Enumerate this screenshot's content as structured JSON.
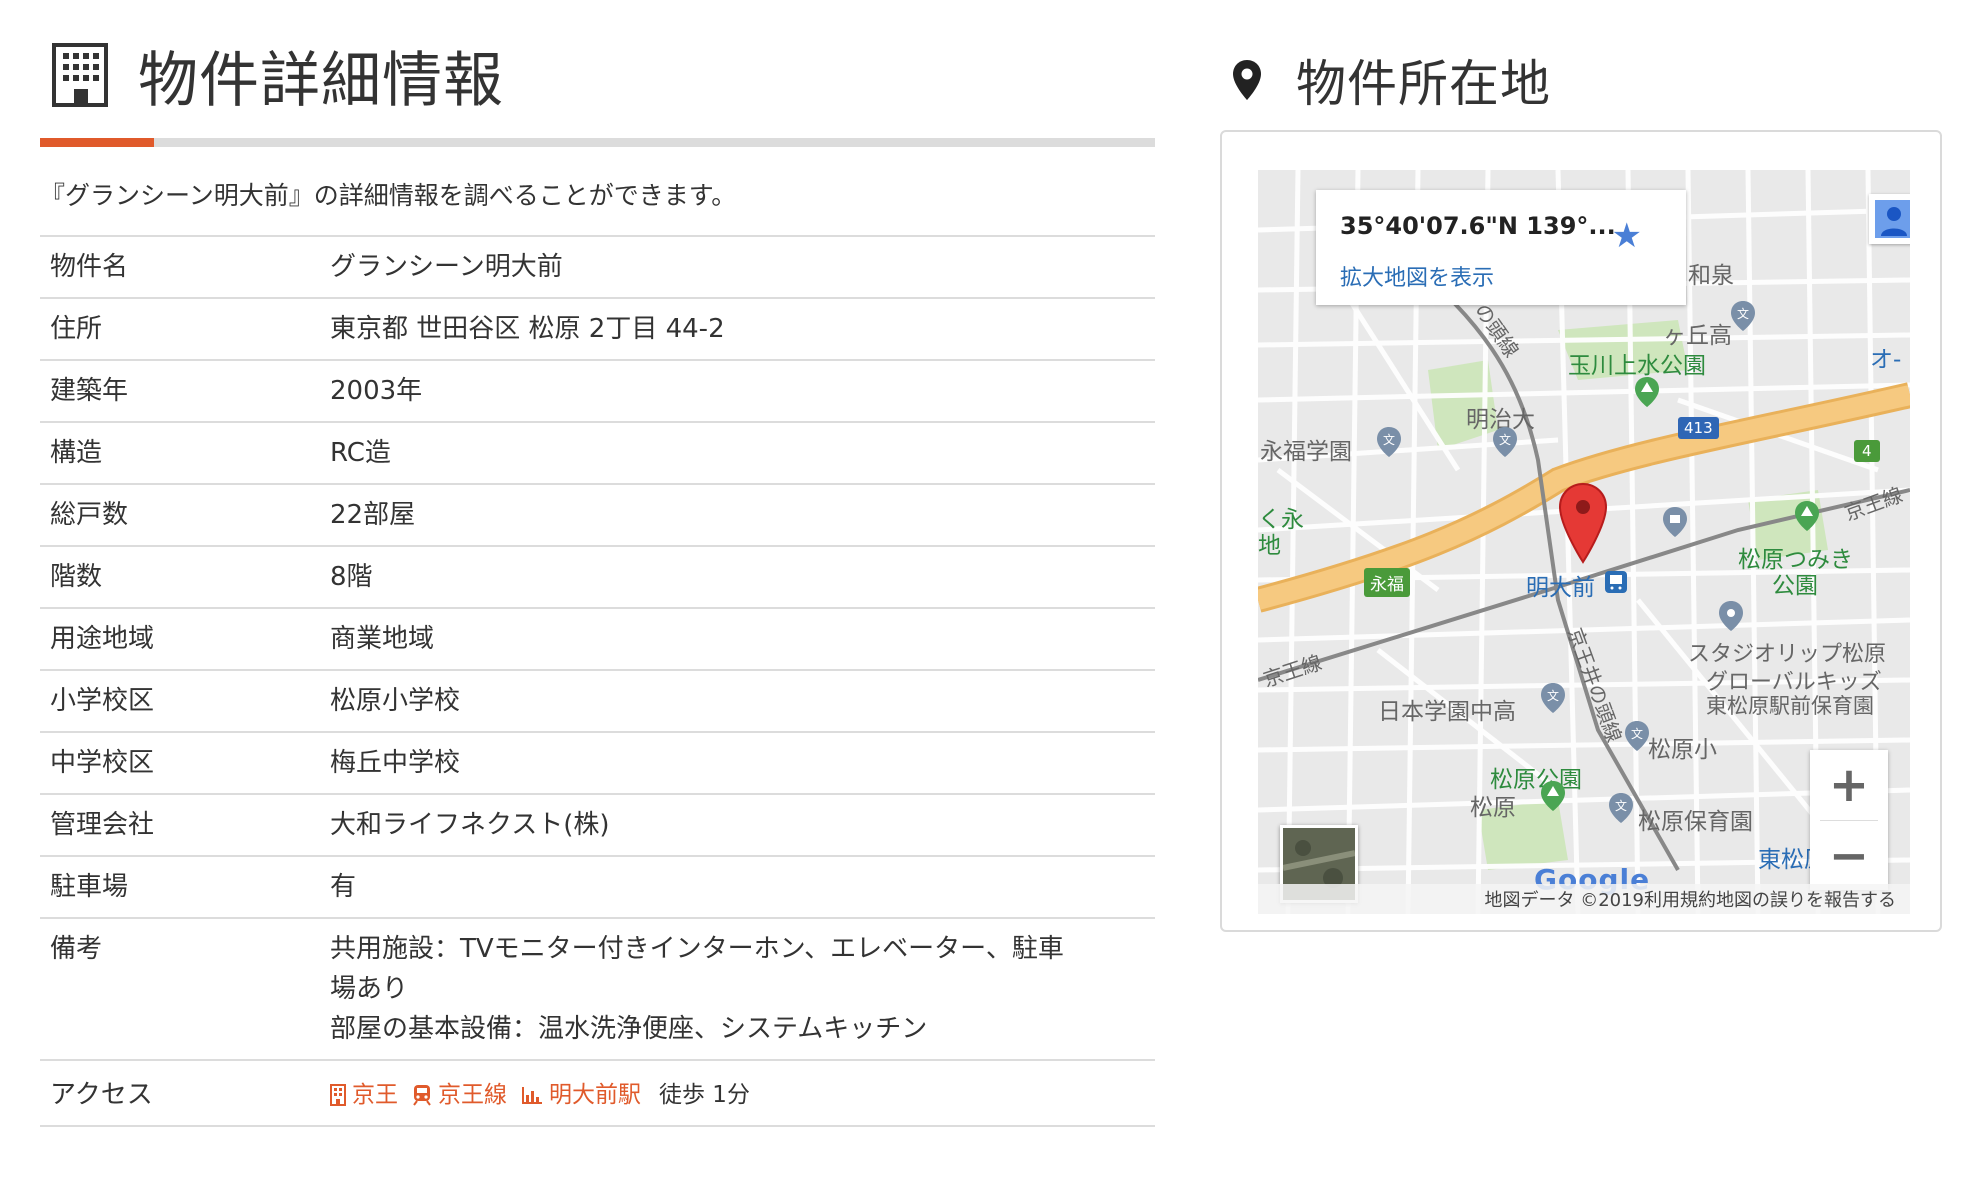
{
  "detail": {
    "title": "物件詳細情報",
    "description": "『グランシーン明大前』の詳細情報を調べることができます。",
    "rows": [
      {
        "label": "物件名",
        "value": "グランシーン明大前"
      },
      {
        "label": "住所",
        "value": "東京都 世田谷区 松原 2丁目 44-2"
      },
      {
        "label": "建築年",
        "value": "2003年"
      },
      {
        "label": "構造",
        "value": "RC造"
      },
      {
        "label": "総戸数",
        "value": "22部屋"
      },
      {
        "label": "階数",
        "value": "8階"
      },
      {
        "label": "用途地域",
        "value": "商業地域"
      },
      {
        "label": "小学校区",
        "value": "松原小学校"
      },
      {
        "label": "中学校区",
        "value": "梅丘中学校"
      },
      {
        "label": "管理会社",
        "value": "大和ライフネクスト(株)"
      },
      {
        "label": "駐車場",
        "value": "有"
      }
    ],
    "remarks": {
      "label": "備考",
      "lines": [
        "共用施設：TVモニター付きインターホン、エレベーター、駐車",
        "場あり",
        "部屋の基本設備：温水洗浄便座、システムキッチン"
      ]
    },
    "access": {
      "label": "アクセス",
      "company": "京王",
      "line": "京王線",
      "station": "明大前駅",
      "walk": "徒歩 1分"
    }
  },
  "location": {
    "title": "物件所在地",
    "map": {
      "coords": "35°40'07.6\"N 139°...",
      "enlarge_link": "拡大地図を表示",
      "labels": {
        "izumi": "和泉",
        "gaoka": "ヶ丘高",
        "o": "オ-",
        "zuisen": "の頭線",
        "tamagawa": "玉川上水公園",
        "meiji": "明治大",
        "eifuku": "永福学園",
        "route413": "413",
        "route4": "4",
        "keio_line_r": "京王線",
        "kuei": "く永",
        "chi": "地",
        "matsubara_tsumiki_1": "松原つみき",
        "matsubara_tsumiki_2": "公園",
        "meidaimae": "明大前",
        "eifuku_sign": "永福",
        "keio_inokashira": "京王井の頭線",
        "studio1": "スタジオリップ松原",
        "studio2": "グローバルキッズ",
        "studio3": "東松原駅前保育園",
        "keio_line_l": "京王線",
        "nihon_gakuen": "日本学園中高",
        "matsubara_sho": "松原小",
        "matsubara_park": "松原公園",
        "matsubara": "松原",
        "matsubara_hoiku": "松原保育園",
        "higashi_matsubara": "東松原"
      },
      "attribution": {
        "data": "地図データ ©2019",
        "terms": "利用規約",
        "report": "地図の誤りを報告する"
      },
      "google": "Google",
      "zoom_in": "+",
      "zoom_out": "−"
    }
  },
  "colors": {
    "accent": "#e05a2b",
    "map_bg": "#e9e9e9",
    "road_major": "#f5c67a",
    "park": "#c8e6b4",
    "link": "#2a6db5"
  }
}
